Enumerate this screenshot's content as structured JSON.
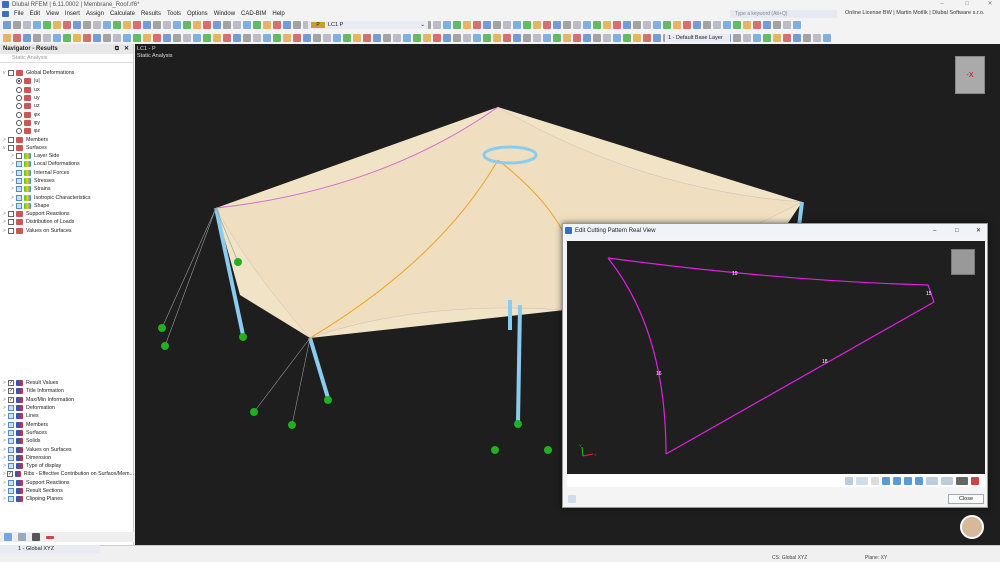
{
  "window": {
    "title": "Dlubal RFEM | 6.11.0002 | Membrane_Roof.rf6*"
  },
  "menu": [
    "File",
    "Edit",
    "View",
    "Insert",
    "Assign",
    "Calculate",
    "Results",
    "Tools",
    "Options",
    "Window",
    "CAD-BIM",
    "Help"
  ],
  "search": {
    "placeholder": "Type a keyword (Alt+Q)"
  },
  "license": "Online License BW | Martin Motlík | Dlubal Software s.r.o.",
  "toolbar": {
    "load_case_tag": "P",
    "load_case": "LC1   P",
    "layer": "1 - Default Base Layer"
  },
  "navigator": {
    "title": "Navigator - Results",
    "analysis": "Static Analysis",
    "tree": [
      {
        "label": "Global Deformations",
        "level": 0,
        "expand": "v",
        "check": "box"
      },
      {
        "label": "|u|",
        "level": 1,
        "check": "radio-on"
      },
      {
        "label": "ux",
        "level": 1,
        "check": "radio"
      },
      {
        "label": "uy",
        "level": 1,
        "check": "radio"
      },
      {
        "label": "uz",
        "level": 1,
        "check": "radio"
      },
      {
        "label": "φx",
        "level": 1,
        "check": "radio"
      },
      {
        "label": "φy",
        "level": 1,
        "check": "radio"
      },
      {
        "label": "φz",
        "level": 1,
        "check": "radio"
      },
      {
        "label": "Members",
        "level": 0,
        "expand": ">",
        "check": "box"
      },
      {
        "label": "Surfaces",
        "level": 0,
        "expand": "v",
        "check": "box"
      },
      {
        "label": "Layer Side",
        "level": 1,
        "expand": ">",
        "check": "box"
      },
      {
        "label": "Local Deformations",
        "level": 1,
        "expand": ">",
        "check": "blue"
      },
      {
        "label": "Internal Forces",
        "level": 1,
        "expand": ">",
        "check": "blue"
      },
      {
        "label": "Stresses",
        "level": 1,
        "expand": ">",
        "check": "blue"
      },
      {
        "label": "Strains",
        "level": 1,
        "expand": ">",
        "check": "blue"
      },
      {
        "label": "Isotropic Characteristics",
        "level": 1,
        "expand": ">",
        "check": "blue"
      },
      {
        "label": "Shape",
        "level": 1,
        "expand": ">",
        "check": "blue"
      },
      {
        "label": "Support Reactions",
        "level": 0,
        "expand": ">",
        "check": "box"
      },
      {
        "label": "Distribution of Loads",
        "level": 0,
        "expand": ">",
        "check": "box"
      },
      {
        "label": "Values on Surfaces",
        "level": 0,
        "expand": ">",
        "check": "box"
      }
    ],
    "display": [
      {
        "label": "Result Values",
        "check": "checked"
      },
      {
        "label": "Title Information",
        "check": "checked"
      },
      {
        "label": "Max/Min Information",
        "check": "checked"
      },
      {
        "label": "Deformation",
        "check": "blue"
      },
      {
        "label": "Lines",
        "check": "blue"
      },
      {
        "label": "Members",
        "check": "blue"
      },
      {
        "label": "Surfaces",
        "check": "blue"
      },
      {
        "label": "Solids",
        "check": "blue"
      },
      {
        "label": "Values on Surfaces",
        "check": "blue"
      },
      {
        "label": "Dimension",
        "check": "blue"
      },
      {
        "label": "Type of display",
        "check": "blue"
      },
      {
        "label": "Ribs - Effective Contribution on Surface/Mem...",
        "check": "checked"
      },
      {
        "label": "Support Reactions",
        "check": "blue"
      },
      {
        "label": "Result Sections",
        "check": "blue"
      },
      {
        "label": "Clipping Planes",
        "check": "blue"
      }
    ]
  },
  "viewport": {
    "load_case": "LC1 - P",
    "analysis": "Static Analysis"
  },
  "dialog": {
    "title": "Edit Cutting Pattern Real View",
    "line_labels": {
      "top": "19",
      "right": "15",
      "diagonal": "18",
      "left": "16"
    },
    "axis_x": "X",
    "axis_y": "Y",
    "close_label": "Close",
    "pattern_color": "#e020e0"
  },
  "status": {
    "coordinate_system": "1 - Global XYZ",
    "cs_text": "CS: Global XYZ",
    "plane_text": "Plane: XY"
  }
}
